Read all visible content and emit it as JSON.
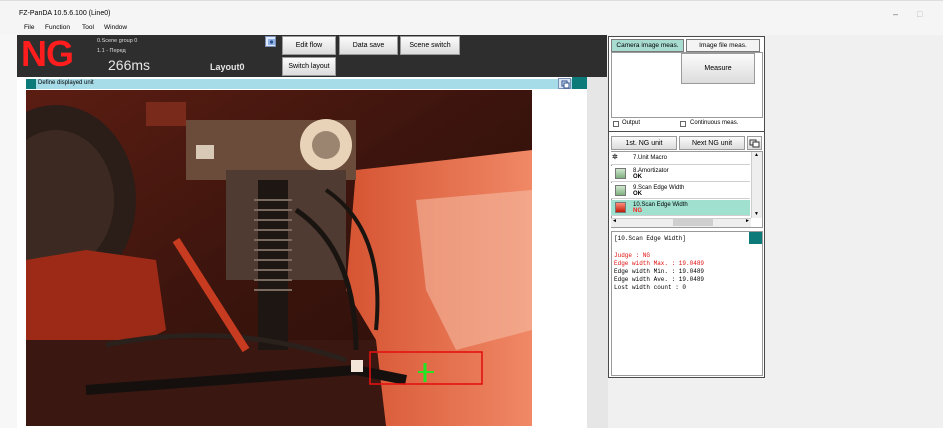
{
  "window": {
    "title": "FZ-PanDA 10.5.6.100 (Line0)",
    "controls": [
      "–",
      "□"
    ]
  },
  "menu": [
    "File",
    "Function",
    "Tool",
    "Window"
  ],
  "status": {
    "judge": "NG",
    "scene_group": "0.Scene group 0",
    "scene": "1.1 - Перед",
    "time": "266ms",
    "layout": "Layout0"
  },
  "toolbar": {
    "edit_flow": "Edit flow",
    "data_save": "Data save",
    "scene_switch": "Scene switch",
    "switch_layout": "Switch layout"
  },
  "viewer": {
    "header": "Define displayed unit"
  },
  "measure": {
    "tabs": [
      "Camera image meas.",
      "Image file meas."
    ],
    "measure_button": "Measure",
    "output_label": "Output",
    "continuous_label": "Continuous meas."
  },
  "nav": {
    "first_ng": "1st. NG unit",
    "next_ng": "Next NG unit"
  },
  "units": [
    {
      "name": "7.Unit Macro",
      "result": "",
      "status": "normal"
    },
    {
      "name": "8.Amortizator",
      "result": "OK",
      "status": "normal"
    },
    {
      "name": "9.Scan Edge Width",
      "result": "OK",
      "status": "normal"
    },
    {
      "name": "10.Scan Edge Width",
      "result": "NG",
      "status": "selected"
    }
  ],
  "details": {
    "title": "[10.Scan Edge Width]",
    "judge": "Judge : NG",
    "width_max": "Edge width Max. : 19.0489",
    "width_min": "Edge width Min. : 19.0489",
    "width_ave": "Edge width Ave. : 19.0489",
    "lost_count": "Lost width count : 0"
  },
  "colors": {
    "ng": "#ff1d1d",
    "ok": "#000000",
    "header_bg": "#2e2e2e",
    "viewer_header": "#a6dbe8",
    "selected_row": "#9fe0cf",
    "accent_teal": "#0b7a78",
    "detail_red": "#e01010"
  },
  "icons": {
    "unit_macro": "unit-macro-icon",
    "unit": "unit-icon",
    "image_settings": "image-settings-icon",
    "copy": "copy-icon"
  }
}
